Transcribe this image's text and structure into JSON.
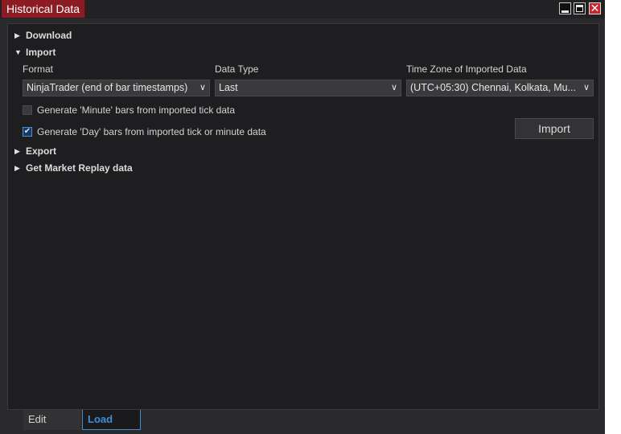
{
  "window": {
    "title": "Historical Data",
    "controls": {
      "minimize": "minimize-icon",
      "maximize": "maximize-icon",
      "close": "close-icon"
    }
  },
  "sections": {
    "download": {
      "label": "Download",
      "expanded": false
    },
    "import": {
      "label": "Import",
      "expanded": true
    },
    "export": {
      "label": "Export",
      "expanded": false
    },
    "replay": {
      "label": "Get Market Replay data",
      "expanded": false
    }
  },
  "import": {
    "format_label": "Format",
    "format_value": "NinjaTrader (end of bar timestamps)",
    "datatype_label": "Data Type",
    "datatype_value": "Last",
    "timezone_label": "Time Zone of Imported Data",
    "timezone_value": "(UTC+05:30) Chennai, Kolkata, Mu...",
    "minute_check_label": "Generate 'Minute' bars from imported tick data",
    "minute_checked": false,
    "day_check_label": "Generate 'Day' bars from imported tick or minute data",
    "day_checked": true,
    "import_button": "Import"
  },
  "tabs": [
    {
      "label": "Edit",
      "active": false
    },
    {
      "label": "Load",
      "active": true
    }
  ],
  "colors": {
    "title_accent": "#8b1c23",
    "active_tab": "#3d8fd6"
  }
}
